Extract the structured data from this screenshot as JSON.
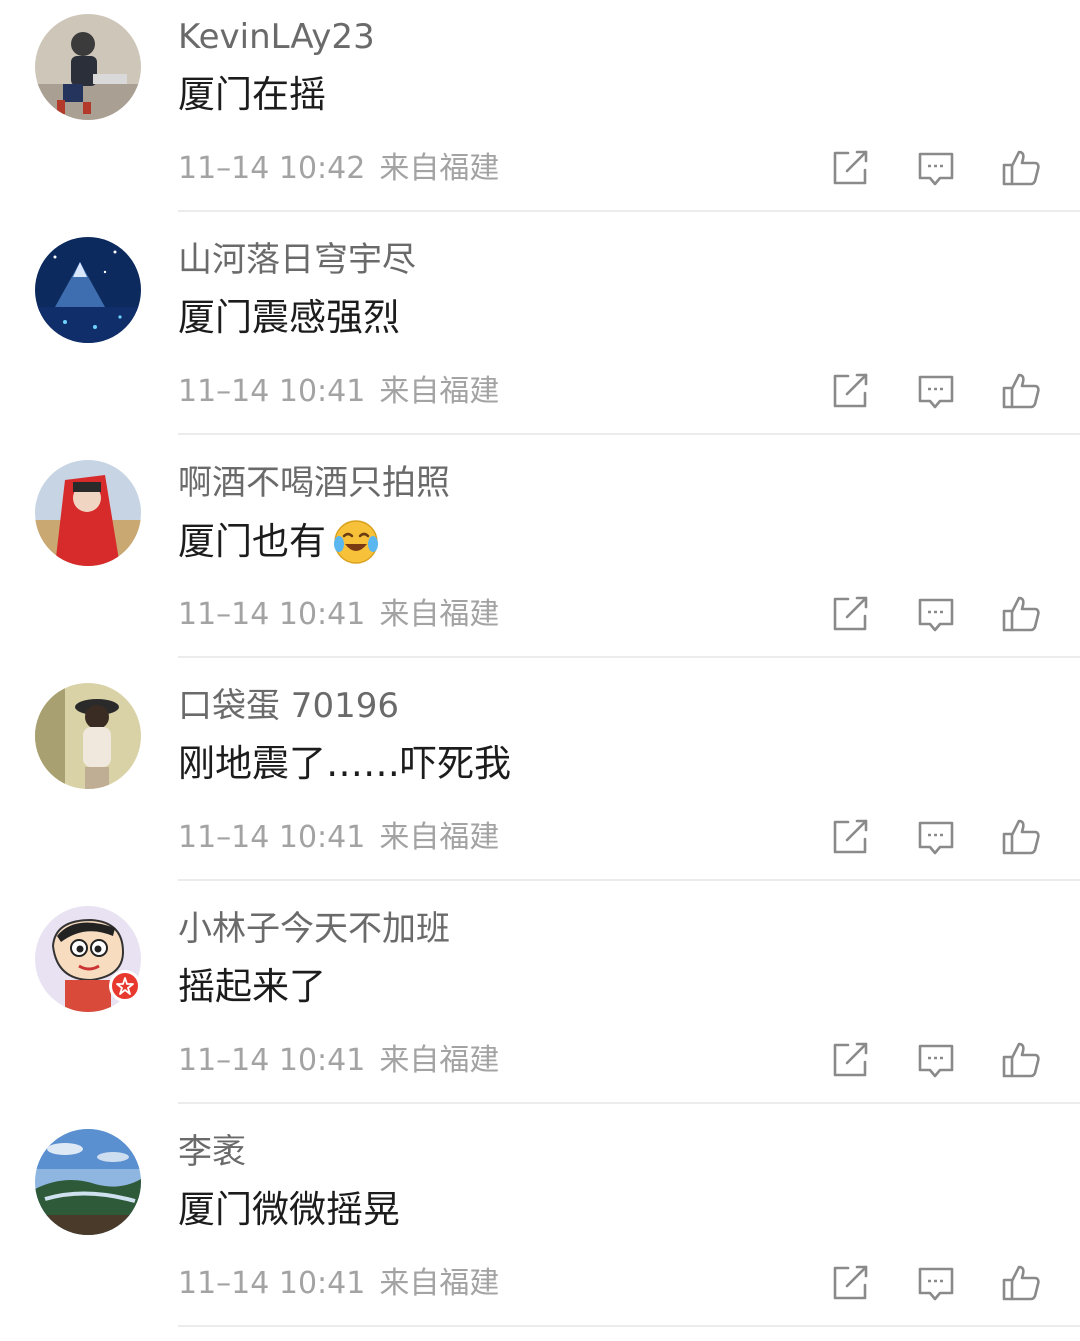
{
  "comments": [
    {
      "username": "KevinLAy23",
      "text": "厦门在摇",
      "time": "11–14 10:42",
      "source": "来自福建",
      "avatar_icon": "avatar-person-photo-icon",
      "has_badge": false,
      "emoji": null
    },
    {
      "username": "山河落日穹宇尽",
      "text": "厦门震感强烈",
      "time": "11–14 10:41",
      "source": "来自福建",
      "avatar_icon": "avatar-starry-mountain-icon",
      "has_badge": false,
      "emoji": null
    },
    {
      "username": "啊酒不喝酒只拍照",
      "text": "厦门也有",
      "time": "11–14 10:41",
      "source": "来自福建",
      "avatar_icon": "avatar-red-veil-portrait-icon",
      "has_badge": false,
      "emoji": "laughing-tears-emoji-icon"
    },
    {
      "username": "口袋蛋 70196",
      "text": "刚地震了……吓死我",
      "time": "11–14 10:41",
      "source": "来自福建",
      "avatar_icon": "avatar-girl-with-hat-icon",
      "has_badge": false,
      "emoji": null
    },
    {
      "username": "小林子今天不加班",
      "text": "摇起来了",
      "time": "11–14 10:41",
      "source": "来自福建",
      "avatar_icon": "avatar-cartoon-boy-icon",
      "has_badge": true,
      "emoji": null
    },
    {
      "username": "李袤",
      "text": "厦门微微摇晃",
      "time": "11–14 10:41",
      "source": "来自福建",
      "avatar_icon": "avatar-landscape-photo-icon",
      "has_badge": false,
      "emoji": null
    }
  ],
  "action_icons": {
    "repost": "repost-icon",
    "comment": "comment-icon",
    "like": "thumbs-up-icon"
  },
  "colors": {
    "username": "#6a6a6a",
    "text": "#1c1c1c",
    "meta": "#a3a3a3",
    "icon": "#8a8a8a",
    "divider": "#ececec",
    "badge": "#e8392f"
  }
}
